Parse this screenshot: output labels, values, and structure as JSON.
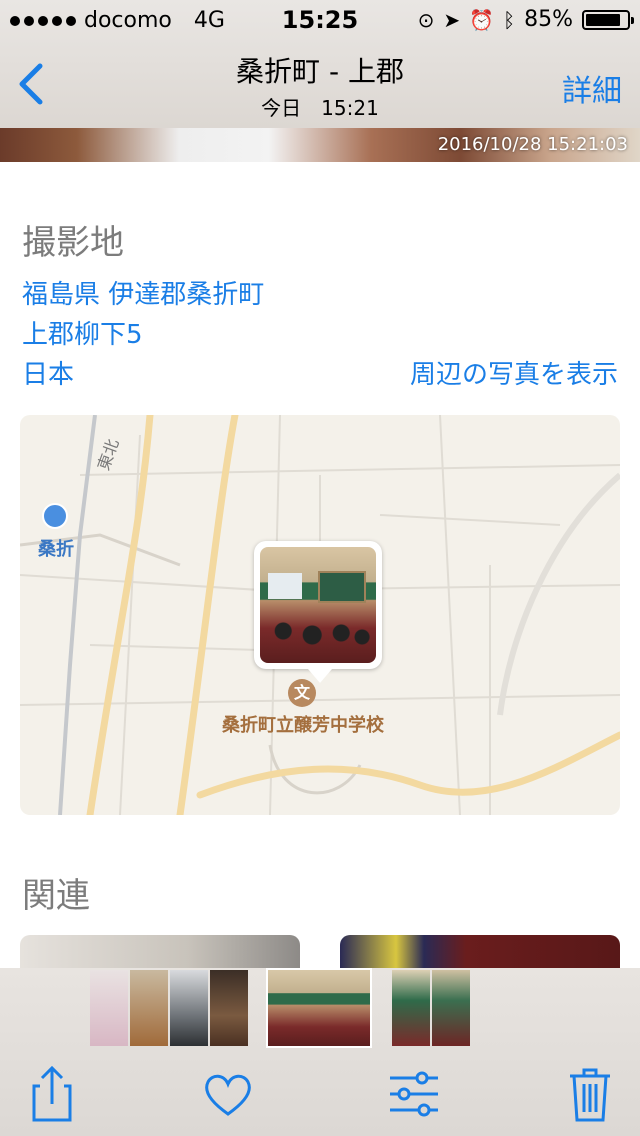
{
  "status_bar": {
    "carrier": "docomo",
    "network": "4G",
    "time": "15:25",
    "battery_percent": "85%"
  },
  "nav": {
    "title": "桑折町 - 上郡",
    "subtitle": "今日　15:21",
    "detail_label": "詳細"
  },
  "photo": {
    "timestamp": "2016/10/28 15:21:03"
  },
  "location": {
    "section_title": "撮影地",
    "address_line1": "福島県 伊達郡桑折町",
    "address_line2": "上郡柳下5",
    "country": "日本",
    "show_nearby_label": "周辺の写真を表示"
  },
  "map": {
    "station_name": "桑折",
    "road_label": "東北",
    "school_icon_glyph": "文",
    "school_name": "桑折町立醸芳中学校"
  },
  "related": {
    "section_title": "関連"
  },
  "toolbar": {
    "icons": [
      "share-icon",
      "heart-icon",
      "adjust-icon",
      "trash-icon"
    ]
  },
  "colors": {
    "accent": "#1a7ee6",
    "section_gray": "#7c7c7c",
    "school_brown": "#a46f3e"
  }
}
